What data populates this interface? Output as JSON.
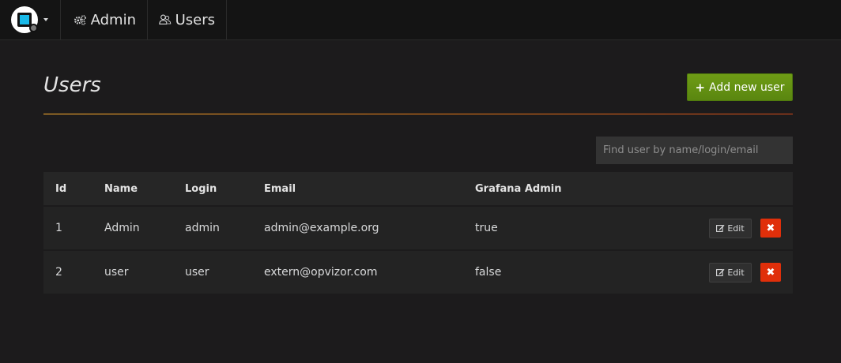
{
  "nav": {
    "items": [
      {
        "label": "Admin",
        "icon": "gears-icon"
      },
      {
        "label": "Users",
        "icon": "users-icon"
      }
    ]
  },
  "page": {
    "title": "Users",
    "add_button": "Add new user",
    "search_placeholder": "Find user by name/login/email"
  },
  "table": {
    "columns": [
      "Id",
      "Name",
      "Login",
      "Email",
      "Grafana Admin"
    ],
    "rows": [
      {
        "id": "1",
        "name": "Admin",
        "login": "admin",
        "email": "admin@example.org",
        "grafana_admin": "true"
      },
      {
        "id": "2",
        "name": "user",
        "login": "user",
        "email": "extern@opvizor.com",
        "grafana_admin": "false"
      }
    ],
    "edit_label": "Edit"
  },
  "colors": {
    "background": "#1c1b1c",
    "navbar": "#141414",
    "add_button": "#6e9c15",
    "delete_button": "#e02f0a",
    "divider_start": "#ffb12f",
    "divider_end": "#d44a1a"
  }
}
